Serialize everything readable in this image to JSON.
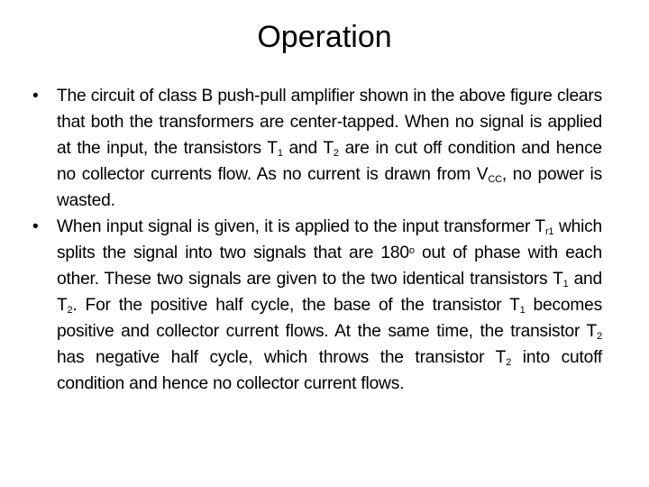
{
  "title": "Operation",
  "bullets": [
    {
      "bullet_symbol": "•",
      "segments": [
        {
          "t": "The circuit of class B push-pull amplifier shown in the above figure clears that both the transformers are center-tapped. When no signal is applied at the input, the transistors T"
        },
        {
          "sub": "1"
        },
        {
          "t": " and T"
        },
        {
          "sub": "2"
        },
        {
          "t": " are in cut off condition and hence no collector currents flow. As no current is drawn from V"
        },
        {
          "sub": "CC"
        },
        {
          "t": ", no power is wasted."
        }
      ]
    },
    {
      "bullet_symbol": "•",
      "segments": [
        {
          "t": "When input signal is given, it is applied to the input transformer T"
        },
        {
          "sub": "r1"
        },
        {
          "t": " which splits the signal into two signals that are 180"
        },
        {
          "sup": "o"
        },
        {
          "t": " out of phase with each other. These two signals are given to the two identical transistors T"
        },
        {
          "sub": "1"
        },
        {
          "t": " and T"
        },
        {
          "sub": "2"
        },
        {
          "t": ". For the positive half cycle, the base of the transistor T"
        },
        {
          "sub": "1"
        },
        {
          "t": " becomes positive and collector current flows. At the same time, the transistor T"
        },
        {
          "sub": "2"
        },
        {
          "t": " has negative half cycle, which throws the transistor T"
        },
        {
          "sub": "2"
        },
        {
          "t": " into cutoff condition and hence no collector current flows."
        }
      ]
    }
  ]
}
